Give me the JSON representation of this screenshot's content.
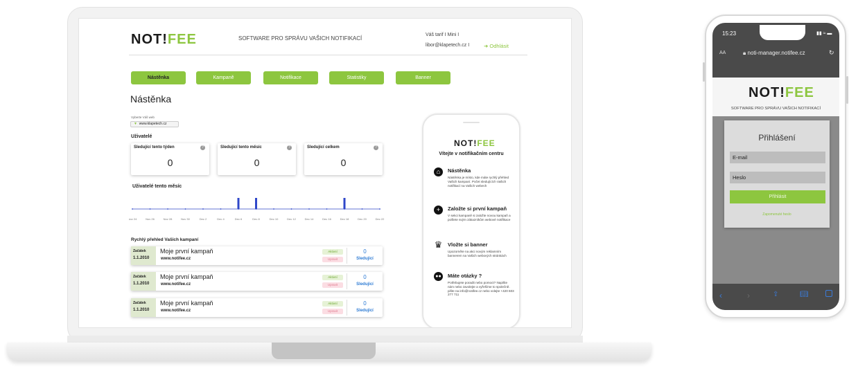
{
  "desktop": {
    "logo": {
      "part1": "NOT!",
      "part2": "FEE"
    },
    "header_tagline": "SOFTWARE PRO SPRÁVU VAŠICH NOTIFIKACÍ",
    "account_line1": "Váš tarif  I  Mini  I",
    "account_email": "libor@klapetech.cz  I",
    "logout": "Odhlásit",
    "nav": [
      "Nástěnka",
      "Kampaně",
      "Notifikace",
      "Statistiky",
      "Banner"
    ],
    "page_title": "Nástěnka",
    "site_select_label": "Vyberte Váš web",
    "site_select_value": "www.klapetech.cz",
    "users_heading": "Uživatelé",
    "stats": [
      {
        "label": "Sledující tento týden",
        "value": "0"
      },
      {
        "label": "Sledující tento měsíc",
        "value": "0"
      },
      {
        "label": "Sledující celkem",
        "value": "0"
      }
    ],
    "chart_heading": "Uživatelé tento měsíc",
    "campaigns_heading": "Rychlý přehled Vašich kampaní",
    "campaigns": [
      {
        "start_label": "Začátek",
        "date": "1.1.2010",
        "name": "Moje první kampaň",
        "url": "www.notifee.cz",
        "status": "Aktivní",
        "edit": "Upravit",
        "count": "0",
        "followers_label": "Sledující"
      },
      {
        "start_label": "Začátek",
        "date": "1.1.2010",
        "name": "Moje první kampaň",
        "url": "www.notifee.cz",
        "status": "Aktivní",
        "edit": "Upravit",
        "count": "0",
        "followers_label": "Sledující"
      },
      {
        "start_label": "Začátek",
        "date": "1.1.2010",
        "name": "Moje první kampaň",
        "url": "www.notifee.cz",
        "status": "Aktivní",
        "edit": "Upravit",
        "count": "0",
        "followers_label": "Sledující"
      }
    ]
  },
  "chart_data": {
    "type": "bar",
    "title": "Uživatelé tento měsíc",
    "categories": [
      "Nov 24",
      "Nov 26",
      "Nov 28",
      "Nov 30",
      "Dec 2",
      "Dec 4",
      "Dec 6",
      "Dec 8",
      "Dec 10",
      "Dec 12",
      "Dec 14",
      "Dec 16",
      "Dec 18",
      "Dec 20",
      "Dec 22"
    ],
    "values": [
      0,
      0,
      0,
      0,
      0,
      0,
      1,
      1,
      0,
      0,
      0,
      0,
      1,
      0,
      0
    ],
    "accent": "#2f47c9"
  },
  "inner_phone": {
    "welcome": "Vítejte v notifikačním centru",
    "sections": [
      {
        "icon": "home-icon",
        "title": "Nástěnka",
        "desc": "Nástěnka je místo, kde máte rychlý přehled Vašich kampaní. Počet sledujících Vašich notifikací na Vašich webech"
      },
      {
        "icon": "plus-circle-icon",
        "title": "Založte si první kampaň",
        "desc": "V sekci kampaně si založte novou kampaň a pošlete svým zákazníkům webové notifikace"
      },
      {
        "icon": "crown-icon",
        "title": "Vložte si banner",
        "desc": "Upozorněte na akci novým reklamním bannerem na Vašich webových stránkách"
      },
      {
        "icon": "chat-icon",
        "title": "Máte otázky ?",
        "desc": "Potřebujete poradit nebo pomoct? Napište nám nebo zavolejte a vyřešíme to společně. pište na info@notifee.cz nebo volejte +420 603 277 711"
      }
    ]
  },
  "mobile": {
    "time": "15:23",
    "aa": "AA",
    "url": "noti-manager.notifee.cz",
    "tagline": "SOFTWARE PRO SPRÁVU VAŠICH NOTIFIKACÍ",
    "login_title": "Přihlášení",
    "email_placeholder": "E-mail",
    "password_placeholder": "Heslo",
    "login_button": "Přihlásit",
    "forgot": "Zapomenuté heslo"
  },
  "colors": {
    "brand_green": "#8dc63f",
    "link_blue": "#2d7bd4"
  }
}
